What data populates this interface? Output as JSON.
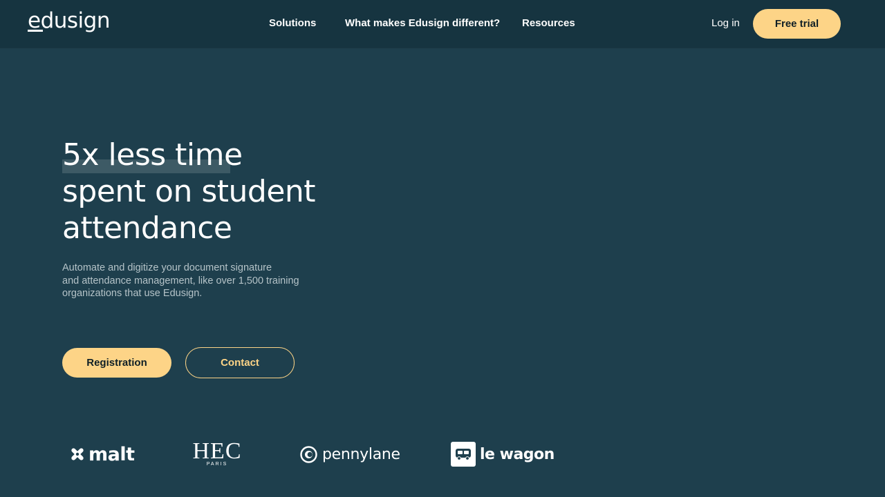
{
  "header": {
    "logo_text": "edusign",
    "nav": {
      "solutions": "Solutions",
      "different": "What makes Edusign different?",
      "resources": "Resources"
    },
    "login": "Log in",
    "free_trial": "Free trial"
  },
  "hero": {
    "title_lines": [
      "5x less time",
      "spent on student",
      "attendance"
    ],
    "subtitle_lines": [
      "Automate and digitize your document signature",
      "and attendance management, like over 1,500 training",
      "organizations that use Edusign."
    ],
    "register_label": "Registration",
    "contact_label": "Contact"
  },
  "client_logos": {
    "malt": "malt",
    "hec": "HEC",
    "hec_sub": "PARIS",
    "pennylane": "pennylane",
    "lewagon": "le wagon"
  },
  "colors": {
    "background": "#1e3f4d",
    "nav_background": "#163440",
    "accent": "#fdd487",
    "subtitle": "#b5c3c8"
  }
}
